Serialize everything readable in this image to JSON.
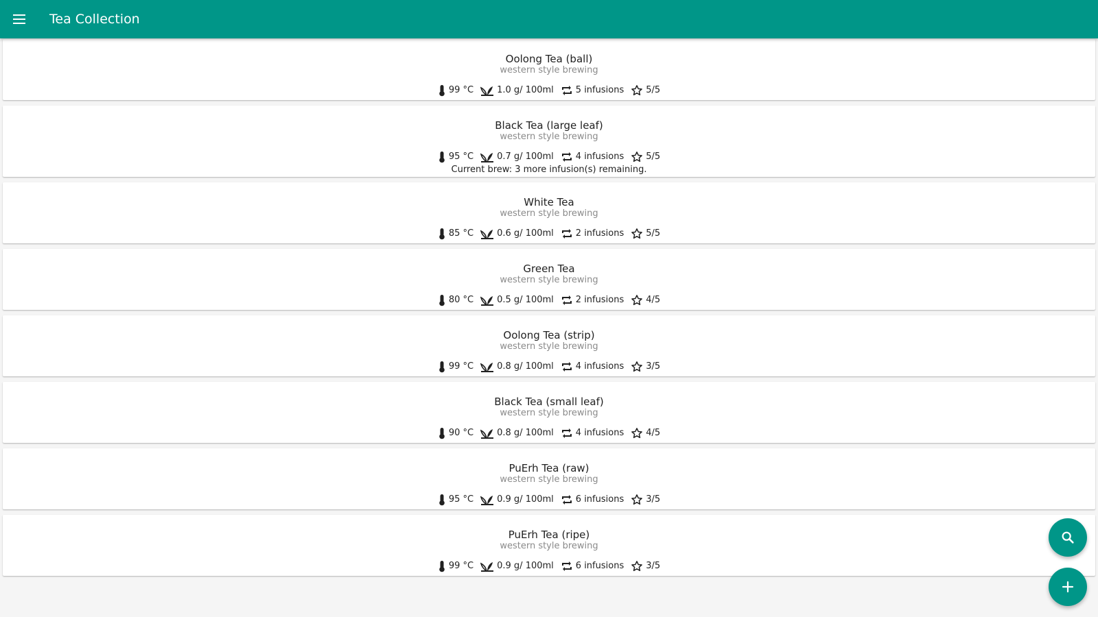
{
  "app_bar": {
    "title": "Tea Collection",
    "menu_icon": "menu-icon",
    "color": "#009688"
  },
  "teas": [
    {
      "name": "Oolong Tea (ball)",
      "style": "western style brewing",
      "temperature": "99 °C",
      "amount": "1.0 g/ 100ml",
      "infusions": "5 infusions",
      "rating": "5/5"
    },
    {
      "name": "Black Tea (large leaf)",
      "style": "western style brewing",
      "temperature": "95 °C",
      "amount": "0.7 g/ 100ml",
      "infusions": "4 infusions",
      "rating": "5/5",
      "brew_status": "Current brew: 3 more infusion(s) remaining."
    },
    {
      "name": "White Tea",
      "style": "western style brewing",
      "temperature": "85 °C",
      "amount": "0.6 g/ 100ml",
      "infusions": "2 infusions",
      "rating": "5/5"
    },
    {
      "name": "Green Tea",
      "style": "western style brewing",
      "temperature": "80 °C",
      "amount": "0.5 g/ 100ml",
      "infusions": "2 infusions",
      "rating": "4/5"
    },
    {
      "name": "Oolong Tea (strip)",
      "style": "western style brewing",
      "temperature": "99 °C",
      "amount": "0.8 g/ 100ml",
      "infusions": "4 infusions",
      "rating": "3/5"
    },
    {
      "name": "Black Tea (small leaf)",
      "style": "western style brewing",
      "temperature": "90 °C",
      "amount": "0.8 g/ 100ml",
      "infusions": "4 infusions",
      "rating": "4/5"
    },
    {
      "name": "PuErh Tea (raw)",
      "style": "western style brewing",
      "temperature": "95 °C",
      "amount": "0.9 g/ 100ml",
      "infusions": "6 infusions",
      "rating": "3/5"
    },
    {
      "name": "PuErh Tea (ripe)",
      "style": "western style brewing",
      "temperature": "99 °C",
      "amount": "0.9 g/ 100ml",
      "infusions": "6 infusions",
      "rating": "3/5"
    }
  ],
  "icons": {
    "temperature": "thermometer-icon",
    "amount": "leaf-icon",
    "infusions": "repeat-icon",
    "rating": "star-outline-icon"
  },
  "fabs": {
    "search_icon": "search-icon",
    "add_icon": "add-icon",
    "color": "#009688"
  }
}
